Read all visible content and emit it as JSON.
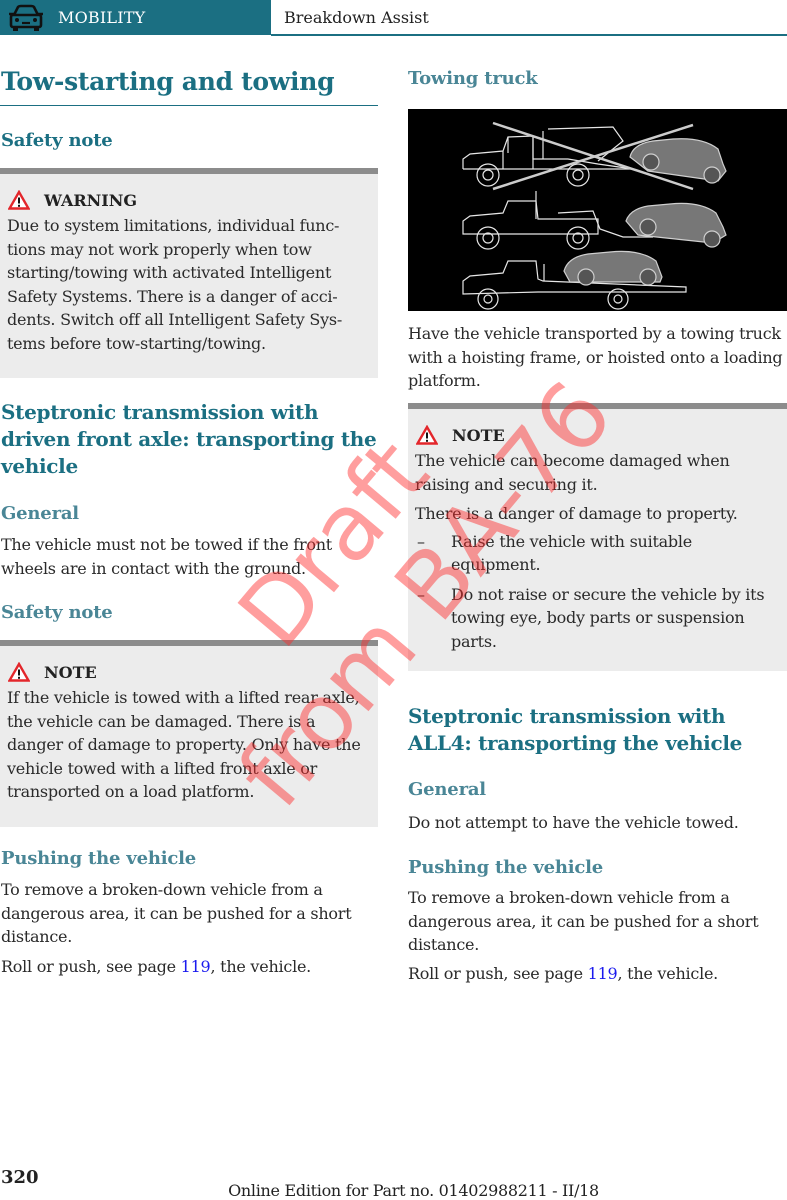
{
  "header": {
    "section_icon": "car-icon",
    "section_label": "MOBILITY",
    "chapter_title": "Breakdown Assist"
  },
  "left": {
    "page_title": "Tow-starting and towing",
    "safety_note_heading": "Safety note",
    "warning_box": {
      "icon": "warning-triangle-icon",
      "title": "WARNING",
      "text": "Due to system limitations, individual functions may not work properly when tow starting/towing with activated Intelligent Safety Systems. There is a danger of accidents. Switch off all Intelligent Safety Systems before tow-starting/towing."
    },
    "section2_heading": "Steptronic transmission with driven front axle: transporting the vehicle",
    "general_heading": "General",
    "general_text": "The vehicle must not be towed if the front wheels are in contact with the ground.",
    "safety_note2_heading": "Safety note",
    "note_box": {
      "icon": "warning-triangle-icon",
      "title": "NOTE",
      "text": "If the vehicle is towed with a lifted rear axle, the vehicle can be damaged. There is a danger of damage to property. Only have the vehicle towed with a lifted front axle or transported on a load platform."
    },
    "pushing_heading": "Pushing the vehicle",
    "pushing_text": "To remove a broken-down vehicle from a dangerous area, it can be pushed for a short distance.",
    "roll_prefix": "Roll or push, see page ",
    "roll_link": "119",
    "roll_suffix": ", the vehicle."
  },
  "right": {
    "towing_truck_heading": "Towing truck",
    "figure_alt": "towing-truck-illustration",
    "towing_text": "Have the vehicle transported by a towing truck with a hoisting frame, or hoisted onto a loading platform.",
    "note_box": {
      "icon": "warning-triangle-icon",
      "title": "NOTE",
      "text1": "The vehicle can become damaged when raising and securing it.",
      "text2": "There is a danger of damage to property.",
      "bullets": [
        "Raise the vehicle with suitable equipment.",
        "Do not raise or secure the vehicle by its towing eye, body parts or suspension parts."
      ],
      "dash": "–"
    },
    "section_heading": "Steptronic transmission with ALL4: transporting the vehicle",
    "general_heading": "General",
    "general_text": "Do not attempt to have the vehicle towed.",
    "pushing_heading": "Pushing the vehicle",
    "pushing_text": "To remove a broken-down vehicle from a dangerous area, it can be pushed for a short distance.",
    "roll_prefix": "Roll or push, see page ",
    "roll_link": "119",
    "roll_suffix": ", the vehicle."
  },
  "footer": {
    "page_number": "320",
    "edition": "Online Edition for Part no. 01402988211 - II/18"
  },
  "watermark": {
    "line1": "Draft",
    "line2": "from BA-76"
  },
  "colors": {
    "accent": "#1b6f82",
    "subheading": "#4a8696",
    "box_bg": "#ececec",
    "box_rule": "#8c8c8c",
    "link": "#1a1aee",
    "warning_red": "#e3262b",
    "watermark": "#ff2828"
  }
}
